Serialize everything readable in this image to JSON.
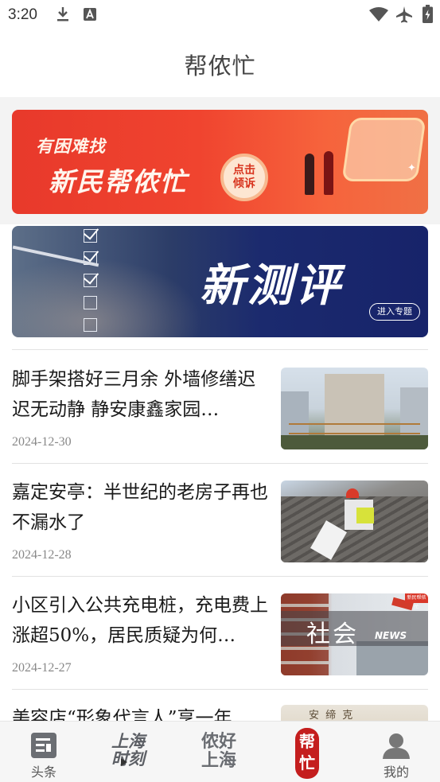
{
  "status_bar": {
    "time": "3:20",
    "icons": [
      "download-icon",
      "text-a-icon",
      "wifi-icon",
      "airplane-icon",
      "battery-charging-icon"
    ]
  },
  "header": {
    "title": "帮侬忙"
  },
  "banners": [
    {
      "line1": "有困难找",
      "line2": "新民帮侬忙",
      "button": "点击\n倾诉",
      "button_l1": "点击",
      "button_l2": "倾诉"
    },
    {
      "title": "新测评",
      "button": "进入专题"
    }
  ],
  "news": [
    {
      "title": "脚手架搭好三月余 外墙修缮迟迟无动静 静安康鑫家园…",
      "date": "2024-12-30",
      "thumb": "building-scaffold"
    },
    {
      "title": "嘉定安亭：半世纪的老房子再也不漏水了",
      "date": "2024-12-28",
      "thumb": "roof-worker"
    },
    {
      "title": "小区引入公共充电桩，充电费上涨超50%，居民质疑为何…",
      "date": "2024-12-27",
      "thumb": "社会",
      "thumb_sub": "NEWS",
      "thumb_tag": "新民帮侬忙"
    },
    {
      "title": "美容店“形象代言人”享一年",
      "date": "",
      "thumb": "安 缔 克"
    }
  ],
  "bottom_nav": [
    {
      "label": "头条",
      "icon": "newspaper-icon"
    },
    {
      "label": "",
      "logo_l1": "上海",
      "logo_l2": "时刻",
      "icon": "shanghai-moment-logo"
    },
    {
      "label": "",
      "logo_l1": "侬好",
      "logo_l2": "上海",
      "icon": "nonghao-shanghai-logo"
    },
    {
      "label": "",
      "logo_l1": "帮",
      "logo_l2": "忙",
      "icon": "bangmang-seal-logo"
    },
    {
      "label": "我的",
      "icon": "person-icon"
    }
  ],
  "colors": {
    "accent_red": "#e8392b",
    "banner_blue": "#1b2a6e"
  }
}
